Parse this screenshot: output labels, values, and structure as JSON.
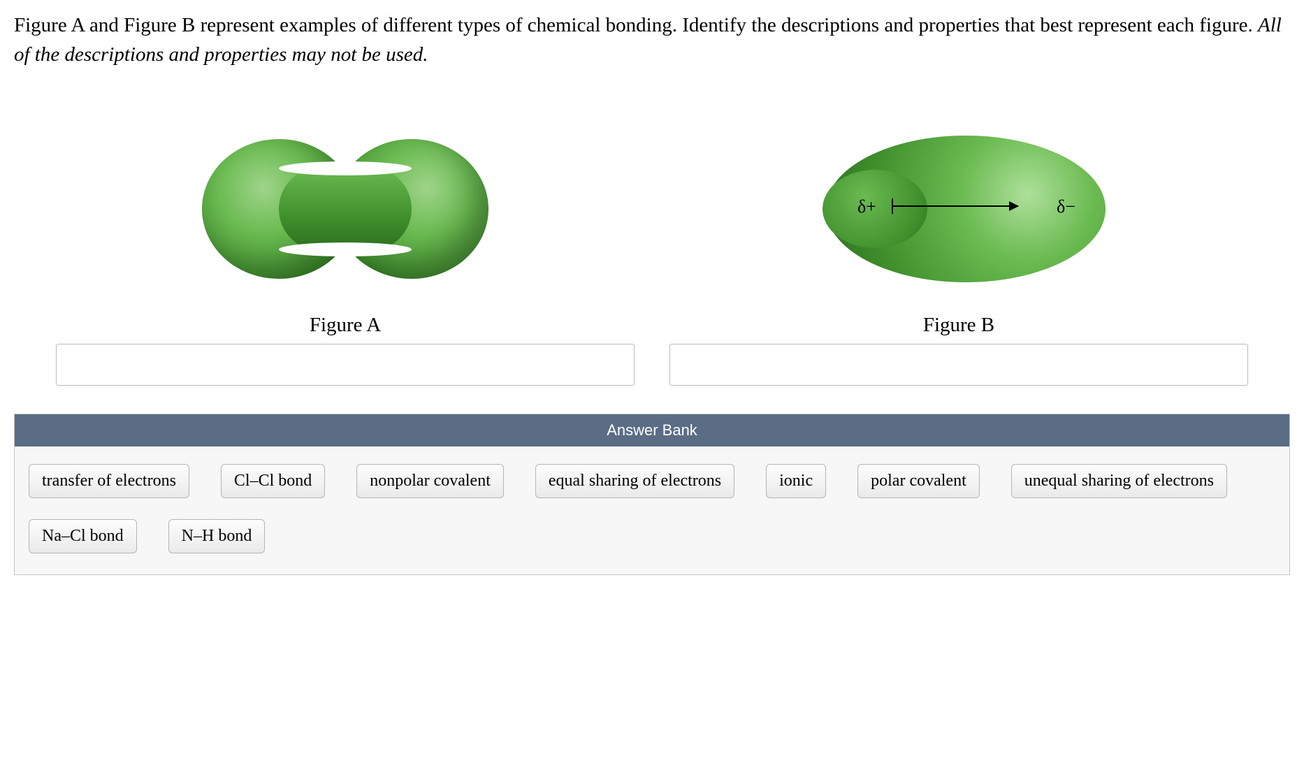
{
  "question": {
    "part1": "Figure A and Figure B represent examples of different types of chemical bonding. Identify the descriptions and properties that best represent each figure. ",
    "part2_italic": "All of the descriptions and properties may not be used."
  },
  "figures": {
    "a": {
      "label": "Figure A"
    },
    "b": {
      "label": "Figure B",
      "delta_plus": "δ+",
      "delta_minus": "δ−"
    }
  },
  "answer_bank": {
    "title": "Answer Bank",
    "chips": [
      "transfer of electrons",
      "Cl–Cl bond",
      "nonpolar covalent",
      "equal sharing of electrons",
      "ionic",
      "polar covalent",
      "unequal sharing of electrons",
      "Na–Cl bond",
      "N–H bond"
    ]
  }
}
